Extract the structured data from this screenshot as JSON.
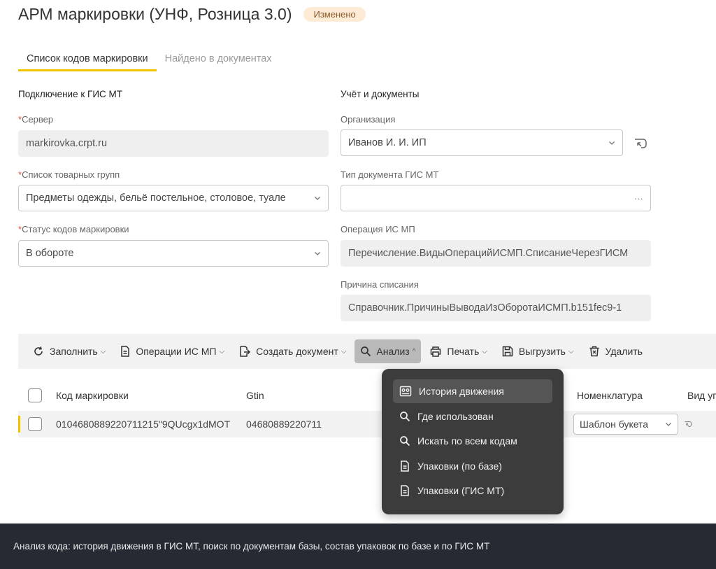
{
  "header": {
    "title": "АРМ маркировки (УНФ, Розница 3.0)",
    "badge": "Изменено"
  },
  "tabs": [
    {
      "label": "Список кодов маркировки",
      "active": true
    },
    {
      "label": "Найдено в документах",
      "active": false
    }
  ],
  "left_section": {
    "title": "Подключение к ГИС МТ",
    "server": {
      "label": "Сервер",
      "value": "markirovka.crpt.ru"
    },
    "product_groups": {
      "label": "Список товарных групп",
      "value": "Предметы одежды, бельё постельное, столовое, туале"
    },
    "code_status": {
      "label": "Статус кодов маркировки",
      "value": "В обороте"
    }
  },
  "right_section": {
    "title": "Учёт и документы",
    "organization": {
      "label": "Организация",
      "value": "Иванов И. И. ИП"
    },
    "doc_type": {
      "label": "Тип документа ГИС МТ",
      "value": "",
      "ellipsis": "···"
    },
    "operation": {
      "label": "Операция ИС МП",
      "value": "Перечисление.ВидыОперацийИСМП.СписаниеЧерезГИСМ"
    },
    "reason": {
      "label": "Причина списания",
      "value": "Справочник.ПричиныВыводаИзОборотаИСМП.b151fec9-1"
    }
  },
  "toolbar": {
    "fill": "Заполнить",
    "ops": "Операции ИС МП",
    "create_doc": "Создать документ",
    "analysis": "Анализ",
    "print": "Печать",
    "export": "Выгрузить",
    "delete": "Удалить"
  },
  "grid": {
    "columns": {
      "code": "Код маркировки",
      "gtin": "Gtin",
      "nomenclature": "Номенклатура",
      "type": "Вид уп"
    },
    "rows": [
      {
        "code": "0104680889220711215\"9QUcgx1dMOT",
        "gtin": "04680889220711",
        "nomenclature": "Шаблон букета"
      }
    ]
  },
  "analysis_menu": {
    "items": [
      {
        "label": "История движения",
        "icon": "history-icon",
        "highlighted": true
      },
      {
        "label": "Где использован",
        "icon": "search-icon"
      },
      {
        "label": "Искать по всем кодам",
        "icon": "search-icon"
      },
      {
        "label": "Упаковки (по базе)",
        "icon": "document-icon"
      },
      {
        "label": "Упаковки (ГИС МТ)",
        "icon": "document-icon"
      }
    ]
  },
  "status_bar": {
    "text": "Анализ кода: история движения в ГИС МТ, поиск по документам базы, состав упаковок по базе и по ГИС МТ"
  },
  "colors": {
    "accent": "#f0c300",
    "badge_bg": "#fdebd6",
    "menu_bg": "#3c3c3c",
    "status_bg": "#262b33"
  }
}
